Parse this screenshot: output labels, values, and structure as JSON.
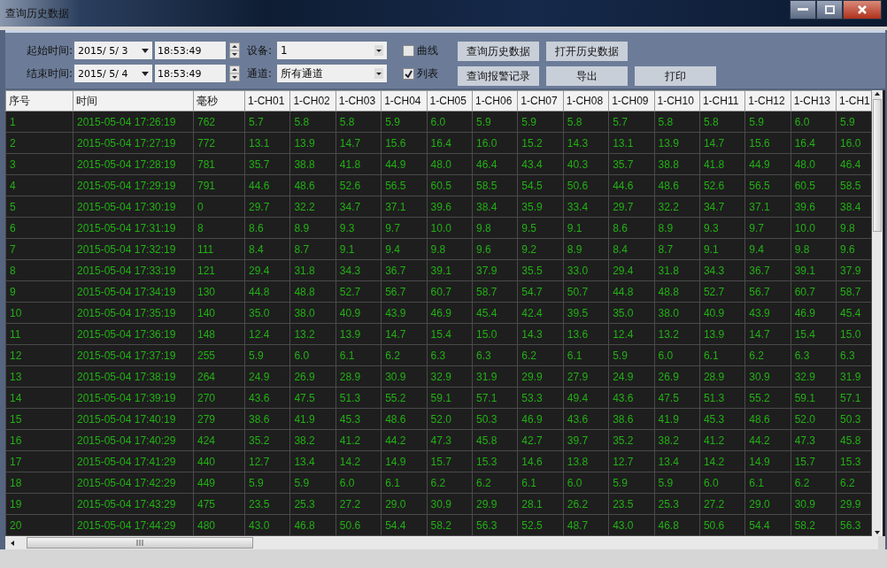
{
  "window": {
    "title": "查询历史数据"
  },
  "filters": [
    {
      "time_label": "起始时间:",
      "date": "2015/ 5/ 3",
      "time": "18:53:49",
      "select_label": "设备:",
      "select_value": "1",
      "checkbox": {
        "label": "曲线",
        "checked": false
      }
    },
    {
      "time_label": "结束时间:",
      "date": "2015/ 5/ 4",
      "time": "18:53:49",
      "select_label": "通道:",
      "select_value": "所有通道",
      "checkbox": {
        "label": "列表",
        "checked": true
      }
    }
  ],
  "button_rows": [
    [
      "查询历史数据",
      "打开历史数据"
    ],
    [
      "查询报警记录",
      "导出",
      "打印"
    ]
  ],
  "table": {
    "columns": [
      "序号",
      "时间",
      "毫秒",
      "1-CH01",
      "1-CH02",
      "1-CH03",
      "1-CH04",
      "1-CH05",
      "1-CH06",
      "1-CH07",
      "1-CH08",
      "1-CH09",
      "1-CH10",
      "1-CH11",
      "1-CH12",
      "1-CH13",
      "1-CH1"
    ],
    "rows": [
      [
        "1",
        "2015-05-04 17:26:19",
        "762",
        "5.7",
        "5.8",
        "5.8",
        "5.9",
        "6.0",
        "5.9",
        "5.9",
        "5.8",
        "5.7",
        "5.8",
        "5.8",
        "5.9",
        "6.0",
        "5.9"
      ],
      [
        "2",
        "2015-05-04 17:27:19",
        "772",
        "13.1",
        "13.9",
        "14.7",
        "15.6",
        "16.4",
        "16.0",
        "15.2",
        "14.3",
        "13.1",
        "13.9",
        "14.7",
        "15.6",
        "16.4",
        "16.0"
      ],
      [
        "3",
        "2015-05-04 17:28:19",
        "781",
        "35.7",
        "38.8",
        "41.8",
        "44.9",
        "48.0",
        "46.4",
        "43.4",
        "40.3",
        "35.7",
        "38.8",
        "41.8",
        "44.9",
        "48.0",
        "46.4"
      ],
      [
        "4",
        "2015-05-04 17:29:19",
        "791",
        "44.6",
        "48.6",
        "52.6",
        "56.5",
        "60.5",
        "58.5",
        "54.5",
        "50.6",
        "44.6",
        "48.6",
        "52.6",
        "56.5",
        "60.5",
        "58.5"
      ],
      [
        "5",
        "2015-05-04 17:30:19",
        "0",
        "29.7",
        "32.2",
        "34.7",
        "37.1",
        "39.6",
        "38.4",
        "35.9",
        "33.4",
        "29.7",
        "32.2",
        "34.7",
        "37.1",
        "39.6",
        "38.4"
      ],
      [
        "6",
        "2015-05-04 17:31:19",
        "8",
        "8.6",
        "8.9",
        "9.3",
        "9.7",
        "10.0",
        "9.8",
        "9.5",
        "9.1",
        "8.6",
        "8.9",
        "9.3",
        "9.7",
        "10.0",
        "9.8"
      ],
      [
        "7",
        "2015-05-04 17:32:19",
        "111",
        "8.4",
        "8.7",
        "9.1",
        "9.4",
        "9.8",
        "9.6",
        "9.2",
        "8.9",
        "8.4",
        "8.7",
        "9.1",
        "9.4",
        "9.8",
        "9.6"
      ],
      [
        "8",
        "2015-05-04 17:33:19",
        "121",
        "29.4",
        "31.8",
        "34.3",
        "36.7",
        "39.1",
        "37.9",
        "35.5",
        "33.0",
        "29.4",
        "31.8",
        "34.3",
        "36.7",
        "39.1",
        "37.9"
      ],
      [
        "9",
        "2015-05-04 17:34:19",
        "130",
        "44.8",
        "48.8",
        "52.7",
        "56.7",
        "60.7",
        "58.7",
        "54.7",
        "50.7",
        "44.8",
        "48.8",
        "52.7",
        "56.7",
        "60.7",
        "58.7"
      ],
      [
        "10",
        "2015-05-04 17:35:19",
        "140",
        "35.0",
        "38.0",
        "40.9",
        "43.9",
        "46.9",
        "45.4",
        "42.4",
        "39.5",
        "35.0",
        "38.0",
        "40.9",
        "43.9",
        "46.9",
        "45.4"
      ],
      [
        "11",
        "2015-05-04 17:36:19",
        "148",
        "12.4",
        "13.2",
        "13.9",
        "14.7",
        "15.4",
        "15.0",
        "14.3",
        "13.6",
        "12.4",
        "13.2",
        "13.9",
        "14.7",
        "15.4",
        "15.0"
      ],
      [
        "12",
        "2015-05-04 17:37:19",
        "255",
        "5.9",
        "6.0",
        "6.1",
        "6.2",
        "6.3",
        "6.3",
        "6.2",
        "6.1",
        "5.9",
        "6.0",
        "6.1",
        "6.2",
        "6.3",
        "6.3"
      ],
      [
        "13",
        "2015-05-04 17:38:19",
        "264",
        "24.9",
        "26.9",
        "28.9",
        "30.9",
        "32.9",
        "31.9",
        "29.9",
        "27.9",
        "24.9",
        "26.9",
        "28.9",
        "30.9",
        "32.9",
        "31.9"
      ],
      [
        "14",
        "2015-05-04 17:39:19",
        "270",
        "43.6",
        "47.5",
        "51.3",
        "55.2",
        "59.1",
        "57.1",
        "53.3",
        "49.4",
        "43.6",
        "47.5",
        "51.3",
        "55.2",
        "59.1",
        "57.1"
      ],
      [
        "15",
        "2015-05-04 17:40:19",
        "279",
        "38.6",
        "41.9",
        "45.3",
        "48.6",
        "52.0",
        "50.3",
        "46.9",
        "43.6",
        "38.6",
        "41.9",
        "45.3",
        "48.6",
        "52.0",
        "50.3"
      ],
      [
        "16",
        "2015-05-04 17:40:29",
        "424",
        "35.2",
        "38.2",
        "41.2",
        "44.2",
        "47.3",
        "45.8",
        "42.7",
        "39.7",
        "35.2",
        "38.2",
        "41.2",
        "44.2",
        "47.3",
        "45.8"
      ],
      [
        "17",
        "2015-05-04 17:41:29",
        "440",
        "12.7",
        "13.4",
        "14.2",
        "14.9",
        "15.7",
        "15.3",
        "14.6",
        "13.8",
        "12.7",
        "13.4",
        "14.2",
        "14.9",
        "15.7",
        "15.3"
      ],
      [
        "18",
        "2015-05-04 17:42:29",
        "449",
        "5.9",
        "5.9",
        "6.0",
        "6.1",
        "6.2",
        "6.2",
        "6.1",
        "6.0",
        "5.9",
        "5.9",
        "6.0",
        "6.1",
        "6.2",
        "6.2"
      ],
      [
        "19",
        "2015-05-04 17:43:29",
        "475",
        "23.5",
        "25.3",
        "27.2",
        "29.0",
        "30.9",
        "29.9",
        "28.1",
        "26.2",
        "23.5",
        "25.3",
        "27.2",
        "29.0",
        "30.9",
        "29.9"
      ],
      [
        "20",
        "2015-05-04 17:44:29",
        "480",
        "43.0",
        "46.8",
        "50.6",
        "54.4",
        "58.2",
        "56.3",
        "52.5",
        "48.7",
        "43.0",
        "46.8",
        "50.6",
        "54.4",
        "58.2",
        "56.3"
      ]
    ]
  }
}
